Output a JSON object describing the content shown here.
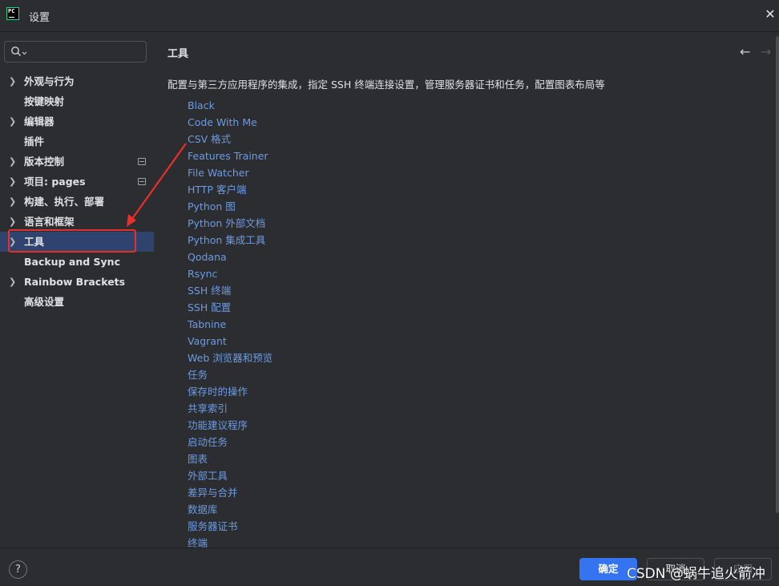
{
  "window": {
    "title": "设置",
    "close_glyph": "✕"
  },
  "search": {
    "placeholder": ""
  },
  "sidebar": {
    "items": [
      {
        "label": "外观与行为",
        "expandable": true
      },
      {
        "label": "按键映射",
        "expandable": false
      },
      {
        "label": "编辑器",
        "expandable": true
      },
      {
        "label": "插件",
        "expandable": false
      },
      {
        "label": "版本控制",
        "expandable": true,
        "project_icon": true
      },
      {
        "label": "项目: pages",
        "expandable": true,
        "project_icon": true
      },
      {
        "label": "构建、执行、部署",
        "expandable": true
      },
      {
        "label": "语言和框架",
        "expandable": true
      },
      {
        "label": "工具",
        "expandable": true,
        "selected": true
      },
      {
        "label": "Backup and Sync",
        "expandable": false
      },
      {
        "label": "Rainbow Brackets",
        "expandable": true
      },
      {
        "label": "高级设置",
        "expandable": false
      }
    ]
  },
  "main": {
    "title": "工具",
    "description": "配置与第三方应用程序的集成，指定 SSH 终端连接设置，管理服务器证书和任务，配置图表布局等",
    "tools": [
      "Black",
      "Code With Me",
      "CSV 格式",
      "Features Trainer",
      "File Watcher",
      "HTTP 客户端",
      "Python 图",
      "Python 外部文档",
      "Python 集成工具",
      "Qodana",
      "Rsync",
      "SSH 终端",
      "SSH 配置",
      "Tabnine",
      "Vagrant",
      "Web 浏览器和预览",
      "任务",
      "保存时的操作",
      "共享索引",
      "功能建议程序",
      "启动任务",
      "图表",
      "外部工具",
      "差异与合并",
      "数据库",
      "服务器证书",
      "终端"
    ]
  },
  "footer": {
    "help": "?",
    "ok": "确定",
    "cancel": "取消",
    "apply": "应用",
    "watermark": "CSDN @蜗牛追火箭冲"
  },
  "colors": {
    "accent": "#3574f0",
    "link": "#6d9be3",
    "selected_bg": "#2e436e",
    "highlight": "#e8302a"
  },
  "icons": [
    "app-icon",
    "close-icon",
    "search-icon",
    "chevron-right-icon",
    "project-scope-icon",
    "back-arrow-icon",
    "forward-arrow-icon",
    "help-icon"
  ]
}
